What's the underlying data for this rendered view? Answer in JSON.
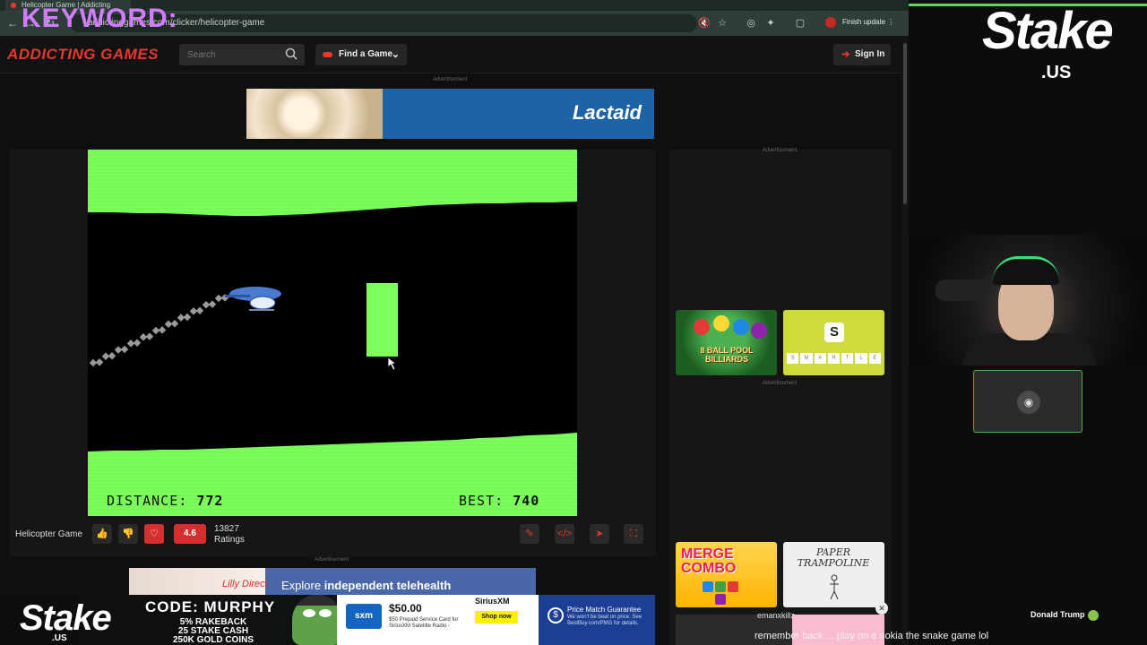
{
  "browser": {
    "tab_title": "Helicopter Game | Addicting",
    "url": "addictinggames.com/clicker/helicopter-game",
    "finish_update": "Finish update"
  },
  "overlay": {
    "keyword": "KEYWORD:"
  },
  "site": {
    "logo": "ADDICTING GAMES",
    "search_placeholder": "Search",
    "find_game": "Find a Game",
    "sign_in": "Sign In",
    "advertisement": "Advertisement"
  },
  "top_ad": {
    "brand": "Lactaid"
  },
  "game": {
    "distance_label": "DISTANCE:",
    "distance_value": "772",
    "best_label": "BEST:",
    "best_value": "740",
    "colors": {
      "wall": "#7cff5b",
      "background": "#000000",
      "smoke": "#9a9a9a"
    }
  },
  "game_bar": {
    "title": "Helicopter Game",
    "rating": "4.6",
    "ratings_count": "13827",
    "ratings_label": "Ratings"
  },
  "thumbnails": {
    "billiards": "8 BALL POOL BILLIARDS",
    "smartle_logo": "S",
    "smartle_tiles": [
      "S",
      "M",
      "A",
      "R",
      "T",
      "L",
      "E"
    ],
    "merge": "MERGE COMBO",
    "paper": "PAPER TRAMPOLINE"
  },
  "bottom_ad": {
    "lilly": "Lilly Direct",
    "text_plain": "Explore ",
    "text_bold": "independent telehealth"
  },
  "stream": {
    "stake": "Stake",
    "stake_us": ".US",
    "chat_name": "Donald Trump",
    "chat_user": "emanxkillz",
    "chat_message": "remember back ... play on a nokia the snake game lol"
  },
  "promo": {
    "stake": "Stake",
    "us": ".US",
    "code": "CODE: MURPHY",
    "line1": "5% RAKEBACK",
    "line2": "25 STAKE CASH",
    "line3": "250K GOLD COINS"
  },
  "sxm_ad": {
    "brand": "SiriusXM",
    "logo": "sxm",
    "price": "$50.00",
    "desc": "$50 Prepaid Service Card for SiriusXM Satellite Radio -",
    "shop": "Shop now"
  },
  "pm_ad": {
    "title": "Price Match Guarantee",
    "desc": "We won't be beat on price. See BestBuy.com/PMG for details."
  }
}
